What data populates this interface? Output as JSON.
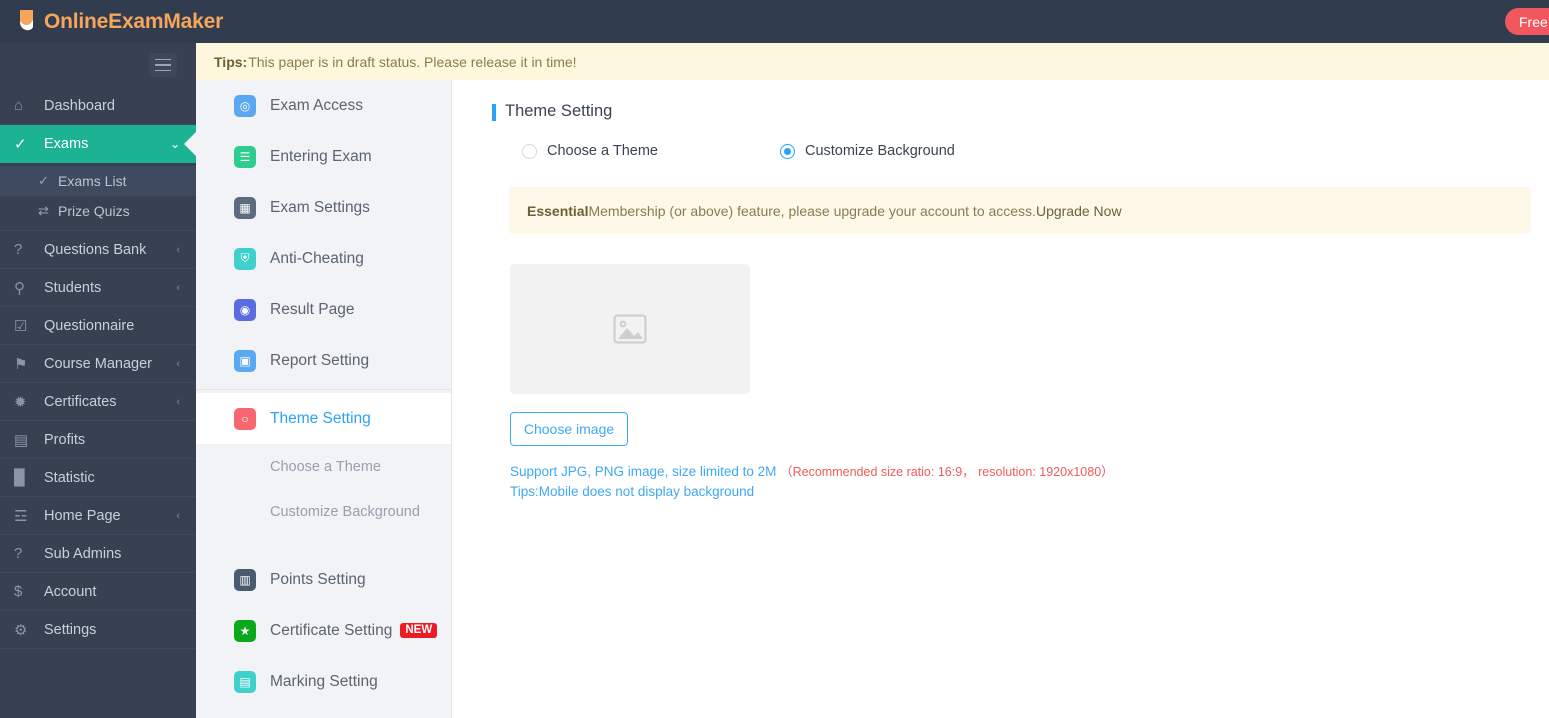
{
  "topbar": {
    "brand": "OnlineExamMaker",
    "brand_color": "#f5a55c",
    "plan_badge": "Free,"
  },
  "tips": {
    "label": "Tips:",
    "text": "This paper is in draft status. Please release it in time!"
  },
  "sidebar": {
    "items": [
      {
        "label": "Dashboard",
        "icon": "home-icon",
        "glyph": "⌂",
        "chevron": "",
        "active": false
      },
      {
        "label": "Exams",
        "icon": "check-circle-icon",
        "glyph": "✓",
        "chevron": "⌄",
        "active": true
      },
      {
        "label": "Questions Bank",
        "icon": "question-circle-icon",
        "glyph": "?",
        "chevron": "‹",
        "active": false
      },
      {
        "label": "Students",
        "icon": "user-icon",
        "glyph": "⚲",
        "chevron": "‹",
        "active": false
      },
      {
        "label": "Questionnaire",
        "icon": "checkbox-icon",
        "glyph": "☑",
        "chevron": "",
        "active": false
      },
      {
        "label": "Course Manager",
        "icon": "graduation-cap-icon",
        "glyph": "⚑",
        "chevron": "‹",
        "active": false
      },
      {
        "label": "Certificates",
        "icon": "rosette-icon",
        "glyph": "✹",
        "chevron": "‹",
        "active": false
      },
      {
        "label": "Profits",
        "icon": "credit-card-icon",
        "glyph": "▤",
        "chevron": "",
        "active": false
      },
      {
        "label": "Statistic",
        "icon": "bar-chart-icon",
        "glyph": "█",
        "chevron": "",
        "active": false
      },
      {
        "label": "Home Page",
        "icon": "sprout-icon",
        "glyph": "☲",
        "chevron": "‹",
        "active": false
      },
      {
        "label": "Sub Admins",
        "icon": "question-circle-icon",
        "glyph": "?",
        "chevron": "",
        "active": false
      },
      {
        "label": "Account",
        "icon": "dollar-icon",
        "glyph": "$",
        "chevron": "",
        "active": false
      },
      {
        "label": "Settings",
        "icon": "gear-icon",
        "glyph": "⚙",
        "chevron": "",
        "active": false
      }
    ],
    "submenu": [
      {
        "label": "Exams List",
        "icon": "check-circle-icon",
        "glyph": "✓",
        "selected": true
      },
      {
        "label": "Prize Quizs",
        "icon": "shuffle-icon",
        "glyph": "⇄",
        "selected": false
      }
    ]
  },
  "subnav": {
    "items": [
      {
        "label": "Exam Access",
        "icon": "exam-access-icon",
        "glyph": "◎",
        "color": "#5aa9f0",
        "active": false,
        "badge": ""
      },
      {
        "label": "Entering Exam",
        "icon": "entering-exam-icon",
        "glyph": "☰",
        "color": "#2ecc8f",
        "active": false,
        "badge": ""
      },
      {
        "label": "Exam Settings",
        "icon": "exam-settings-icon",
        "glyph": "▦",
        "color": "#5c6b7e",
        "active": false,
        "badge": ""
      },
      {
        "label": "Anti-Cheating",
        "icon": "shield-icon",
        "glyph": "⛨",
        "color": "#3fd0ce",
        "active": false,
        "badge": ""
      },
      {
        "label": "Result Page",
        "icon": "eye-icon",
        "glyph": "◉",
        "color": "#5a6ce0",
        "active": false,
        "badge": ""
      },
      {
        "label": "Report Setting",
        "icon": "report-icon",
        "glyph": "▣",
        "color": "#5aa9f0",
        "active": false,
        "badge": ""
      }
    ],
    "theme": {
      "label": "Theme Setting",
      "icon": "shirt-icon",
      "glyph": "○",
      "color": "#f8666f",
      "active": true
    },
    "theme_children": [
      {
        "label": "Choose a Theme"
      },
      {
        "label": "Customize Background"
      }
    ],
    "items2": [
      {
        "label": "Points Setting",
        "icon": "points-icon",
        "glyph": "▥",
        "color": "#4a5a6e",
        "active": false,
        "badge": ""
      },
      {
        "label": "Certificate Setting",
        "icon": "certificate-icon",
        "glyph": "★",
        "color": "#0aa81a",
        "active": false,
        "badge": "NEW"
      },
      {
        "label": "Marking Setting",
        "icon": "marking-icon",
        "glyph": "▤",
        "color": "#3fd0ce",
        "active": false,
        "badge": ""
      }
    ]
  },
  "main": {
    "title": "Theme Setting",
    "accent_color": "#2aa2f7",
    "options": [
      {
        "label": "Choose a Theme",
        "selected": false
      },
      {
        "label": "Customize Background",
        "selected": true
      }
    ],
    "notice": {
      "bold": "Essential",
      "text": " Membership (or above) feature, please upgrade your account to access. ",
      "link": "Upgrade Now"
    },
    "upload": {
      "preview_icon": "image-placeholder-icon",
      "button": "Choose image",
      "support_text": "Support JPG, PNG image, size limited to 2M",
      "support_hint": "（Recommended size ratio: 16:9， resolution: 1920x1080）",
      "mobile_tip": "Tips:Mobile does not display background"
    }
  }
}
